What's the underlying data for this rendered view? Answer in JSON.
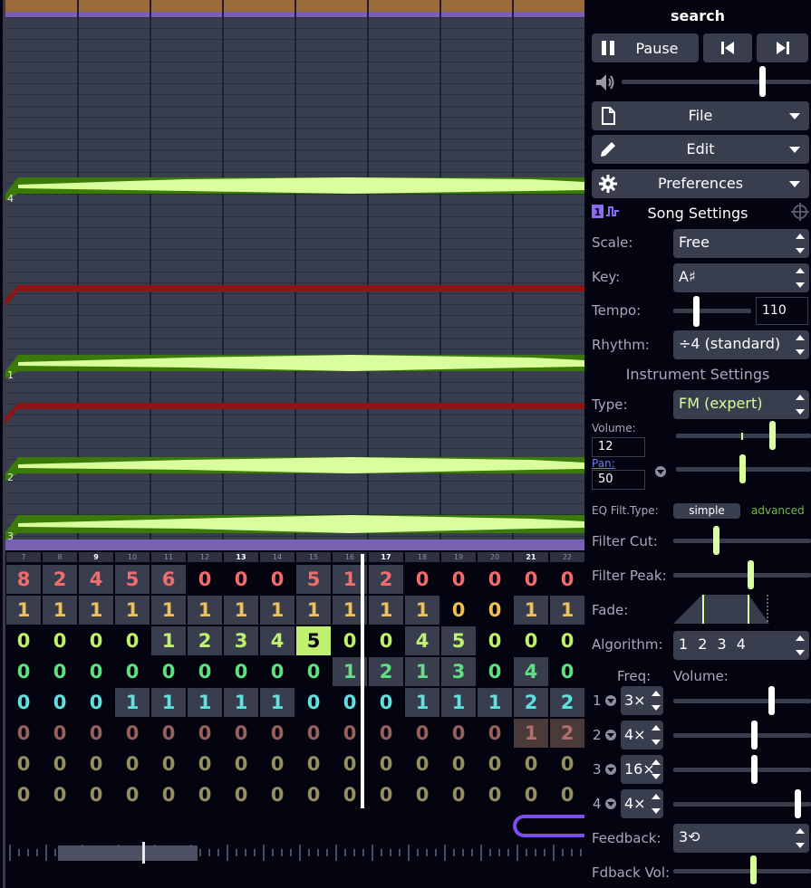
{
  "colors": {
    "background": "#040410",
    "panel_control": "#393e4f",
    "note_channel": "#d8ff9c",
    "note_outline": "#3b7a08",
    "mod_line": "#8c1515",
    "purple": "#7a60b0",
    "playhead": "#ffffff"
  },
  "piano_roll": {
    "track_labels": [
      "4",
      "1",
      "2",
      "3"
    ]
  },
  "pattern": {
    "columns": [
      "7",
      "8",
      "9",
      "10",
      "11",
      "12",
      "13",
      "14",
      "15",
      "16",
      "17",
      "18",
      "19",
      "20",
      "21",
      "22"
    ],
    "bold_columns": [
      "9",
      "13",
      "17",
      "21"
    ],
    "rows": [
      {
        "color": "#f06d6d",
        "values": [
          "8",
          "2",
          "4",
          "5",
          "6",
          "0",
          "0",
          "0",
          "5",
          "1",
          "2",
          "0",
          "0",
          "0",
          "0",
          "0"
        ],
        "highlighted": [
          0,
          1,
          2,
          3,
          4,
          8,
          9,
          10
        ],
        "dim": [
          5,
          6,
          7,
          11,
          12,
          13,
          14,
          15
        ]
      },
      {
        "color": "#f0c050",
        "values": [
          "1",
          "1",
          "1",
          "1",
          "1",
          "1",
          "1",
          "1",
          "1",
          "1",
          "1",
          "1",
          "0",
          "0",
          "1",
          "1"
        ],
        "highlighted": [
          0,
          1,
          2,
          3,
          4,
          5,
          6,
          7,
          8,
          9,
          10,
          11,
          14,
          15
        ],
        "dim": [
          12,
          13
        ]
      },
      {
        "color": "#c0f070",
        "values": [
          "0",
          "0",
          "0",
          "0",
          "1",
          "2",
          "3",
          "4",
          "5",
          "0",
          "0",
          "4",
          "5",
          "0",
          "0",
          "0"
        ],
        "highlighted": [
          4,
          5,
          6,
          7,
          11,
          12
        ],
        "dim": [
          0,
          1,
          2,
          3,
          9,
          10,
          13,
          14,
          15
        ],
        "selected": 8
      },
      {
        "color": "#60e080",
        "values": [
          "0",
          "0",
          "0",
          "0",
          "0",
          "0",
          "0",
          "0",
          "0",
          "1",
          "2",
          "1",
          "3",
          "0",
          "4",
          "0"
        ],
        "highlighted": [
          9,
          10,
          11,
          12,
          14
        ],
        "dim": [
          0,
          1,
          2,
          3,
          4,
          5,
          6,
          7,
          8,
          13,
          15
        ]
      },
      {
        "color": "#60e0e0",
        "values": [
          "0",
          "0",
          "0",
          "1",
          "1",
          "1",
          "1",
          "1",
          "0",
          "0",
          "0",
          "1",
          "1",
          "1",
          "2",
          "2"
        ],
        "highlighted": [
          3,
          4,
          5,
          6,
          7,
          11,
          12,
          13,
          14,
          15
        ],
        "dim": [
          0,
          1,
          2,
          8,
          9,
          10
        ]
      },
      {
        "color": "#b07068",
        "values": [
          "0",
          "0",
          "0",
          "0",
          "0",
          "0",
          "0",
          "0",
          "0",
          "0",
          "0",
          "0",
          "0",
          "0",
          "1",
          "2"
        ],
        "highlighted": [
          14,
          15
        ],
        "dim": [
          0,
          1,
          2,
          3,
          4,
          5,
          6,
          7,
          8,
          9,
          10,
          11,
          12,
          13
        ]
      },
      {
        "color": "#b0a870",
        "values": [
          "0",
          "0",
          "0",
          "0",
          "0",
          "0",
          "0",
          "0",
          "0",
          "0",
          "0",
          "0",
          "0",
          "0",
          "0",
          "0"
        ],
        "highlighted": [],
        "dim": [
          0,
          1,
          2,
          3,
          4,
          5,
          6,
          7,
          8,
          9,
          10,
          11,
          12,
          13,
          14,
          15
        ]
      },
      {
        "color": "#b0a870",
        "values": [
          "0",
          "0",
          "0",
          "0",
          "0",
          "0",
          "0",
          "0",
          "0",
          "0",
          "0",
          "0",
          "0",
          "0",
          "0",
          "0"
        ],
        "highlighted": [],
        "dim": [
          0,
          1,
          2,
          3,
          4,
          5,
          6,
          7,
          8,
          9,
          10,
          11,
          12,
          13,
          14,
          15
        ]
      }
    ]
  },
  "panel": {
    "title": "search",
    "pause_label": "Pause",
    "file_label": "File",
    "edit_label": "Edit",
    "prefs_label": "Preferences",
    "song_settings": "Song Settings",
    "scale_label": "Scale:",
    "scale_value": "Free",
    "key_label": "Key:",
    "key_value": "A♯",
    "tempo_label": "Tempo:",
    "tempo_value": "110",
    "rhythm_label": "Rhythm:",
    "rhythm_value": "÷4 (standard)",
    "instrument_settings": "Instrument Settings",
    "type_label": "Type:",
    "type_value": "FM (expert)",
    "volume_label": "Volume:",
    "volume_value": "12",
    "pan_label": "Pan:",
    "pan_value": "50",
    "eq_label": "EQ Filt.Type:",
    "eq_simple": "simple",
    "eq_advanced": "advanced",
    "filter_cut_label": "Filter Cut:",
    "filter_peak_label": "Filter Peak:",
    "fade_label": "Fade:",
    "algorithm_label": "Algorithm:",
    "algorithm_value": "1 2 3 4",
    "freq_header": "Freq:",
    "volume_header": "Volume:",
    "operators": [
      {
        "num": "1",
        "freq": "3×"
      },
      {
        "num": "2",
        "freq": "4×"
      },
      {
        "num": "3",
        "freq": "16×"
      },
      {
        "num": "4",
        "freq": "4×"
      }
    ],
    "feedback_label": "Feedback:",
    "feedback_value": "3⟲",
    "fdback_vol_label": "Fdback Vol:"
  }
}
